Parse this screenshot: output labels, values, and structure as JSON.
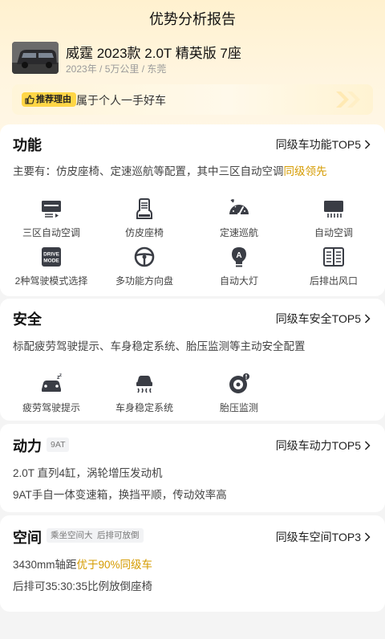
{
  "header": {
    "title": "优势分析报告"
  },
  "car": {
    "name": "威霆 2023款 2.0T 精英版 7座",
    "meta": "2023年 / 5万公里 / 东莞"
  },
  "reason": {
    "tag": "推荐理由",
    "text": "属于个人一手好车"
  },
  "function_section": {
    "title": "功能",
    "more": "同级车功能TOP5",
    "desc_prefix": "主要有：仿皮座椅、定速巡航等配置，其中三区自动空调",
    "desc_highlight": "同级领先",
    "items": [
      {
        "label": "三区自动空调",
        "icon": "climate-zone-icon"
      },
      {
        "label": "仿皮座椅",
        "icon": "seat-icon"
      },
      {
        "label": "定速巡航",
        "icon": "speedometer-icon"
      },
      {
        "label": "自动空调",
        "icon": "ac-vent-icon"
      },
      {
        "label": "2种驾驶模式选择",
        "icon": "drive-mode-icon"
      },
      {
        "label": "多功能方向盘",
        "icon": "steering-wheel-icon"
      },
      {
        "label": "自动大灯",
        "icon": "auto-headlight-icon"
      },
      {
        "label": "后排出风口",
        "icon": "rear-vent-icon"
      }
    ],
    "drive_mode_text": "DRIVE MODE",
    "auto_light_text": "A"
  },
  "safety_section": {
    "title": "安全",
    "more": "同级车安全TOP5",
    "desc": "标配疲劳驾驶提示、车身稳定系统、胎压监测等主动安全配置",
    "items": [
      {
        "label": "疲劳驾驶提示",
        "icon": "fatigue-alert-icon"
      },
      {
        "label": "车身稳定系统",
        "icon": "stability-control-icon"
      },
      {
        "label": "胎压监测",
        "icon": "tire-pressure-icon"
      }
    ]
  },
  "power_section": {
    "title": "动力",
    "tag": "9AT",
    "more": "同级车动力TOP5",
    "lines": [
      "2.0T 直列4缸，涡轮增压发动机",
      "9AT手自一体变速箱，换挡平顺，传动效率高"
    ]
  },
  "space_section": {
    "title": "空间",
    "tags": [
      "乘坐空间大",
      "后排可放倒"
    ],
    "more": "同级车空间TOP3",
    "line1_prefix": "3430mm轴距",
    "line1_highlight": "优于90%同级车",
    "line2": "后排可35:30:35比例放倒座椅"
  },
  "colors": {
    "accent": "#ffd646",
    "highlight": "#d59b00",
    "icon": "#3a3d45"
  }
}
